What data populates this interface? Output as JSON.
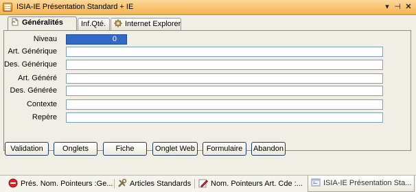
{
  "window": {
    "title": "ISIA-IE Présentation Standard + IE",
    "dropdown_glyph": "▾",
    "pin_glyph": "⊣",
    "close_glyph": "✕"
  },
  "tabs": [
    {
      "label": "Généralités",
      "icon": "document-icon"
    },
    {
      "label": "Inf.Qté.",
      "icon": ""
    },
    {
      "label": "Internet Explorer",
      "icon": "gear-icon"
    }
  ],
  "form": {
    "niveau_label": "Niveau",
    "niveau_value": "0",
    "fields": [
      {
        "label": "Art. Générique",
        "value": ""
      },
      {
        "label": "Des. Générique",
        "value": ""
      },
      {
        "label": "Art. Généré",
        "value": ""
      },
      {
        "label": "Des. Générée",
        "value": ""
      },
      {
        "label": "Contexte",
        "value": ""
      },
      {
        "label": "Repère",
        "value": ""
      }
    ]
  },
  "buttons": {
    "validation": "Validation",
    "onglets": "Onglets",
    "fiche": "Fiche",
    "onglet_web": "Onglet Web",
    "formulaire": "Formulaire",
    "abandon": "Abandon"
  },
  "bottom_tabs": [
    {
      "label": "Prés. Nom. Pointeurs :Ge...",
      "icon": "no-entry-icon"
    },
    {
      "label": "Articles Standards",
      "icon": "tools-icon"
    },
    {
      "label": "Nom. Pointeurs Art. Cde :...",
      "icon": "pen-icon"
    },
    {
      "label": "ISIA-IE Présentation Sta...",
      "icon": "window-icon"
    }
  ],
  "colors": {
    "title_bar": "#f6b24d",
    "selection": "#316ac5",
    "field_border": "#7f9db9"
  }
}
